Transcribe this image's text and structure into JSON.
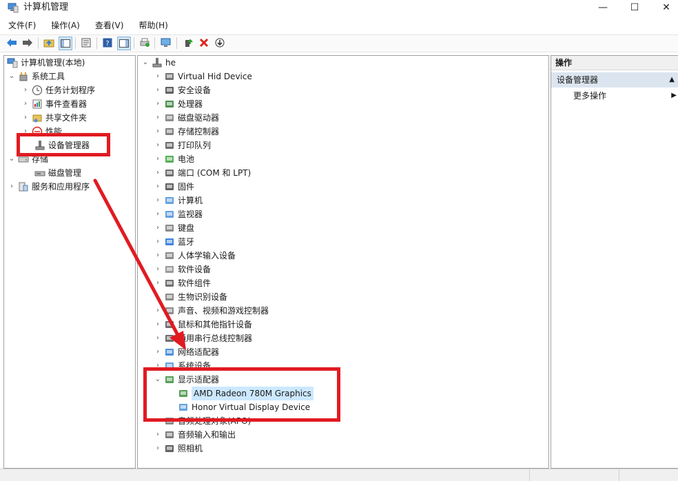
{
  "window": {
    "title": "计算机管理",
    "minimize": "—",
    "maximize": "☐",
    "close": "✕"
  },
  "menu": [
    "文件(F)",
    "操作(A)",
    "查看(V)",
    "帮助(H)"
  ],
  "left_tree": [
    {
      "label": "计算机管理(本地)",
      "icon": "computer-management-icon",
      "depth": 0,
      "arrow": ""
    },
    {
      "label": "系统工具",
      "icon": "tools-icon",
      "depth": 1,
      "arrow": "⌄"
    },
    {
      "label": "任务计划程序",
      "icon": "clock-icon",
      "depth": 2,
      "arrow": "›"
    },
    {
      "label": "事件查看器",
      "icon": "event-viewer-icon",
      "depth": 2,
      "arrow": "›"
    },
    {
      "label": "共享文件夹",
      "icon": "shared-folder-icon",
      "depth": 2,
      "arrow": "›"
    },
    {
      "label": "性能",
      "icon": "performance-icon",
      "depth": 2,
      "arrow": "›"
    },
    {
      "label": "设备管理器",
      "icon": "device-manager-icon",
      "depth": 2,
      "arrow": ""
    },
    {
      "label": "存储",
      "icon": "storage-icon",
      "depth": 1,
      "arrow": "⌄"
    },
    {
      "label": "磁盘管理",
      "icon": "disk-management-icon",
      "depth": 2,
      "arrow": ""
    },
    {
      "label": "服务和应用程序",
      "icon": "services-icon",
      "depth": 1,
      "arrow": "›"
    }
  ],
  "device_tree": {
    "root": "he",
    "categories": [
      {
        "label": "Virtual Hid Device",
        "icon": "hid-icon"
      },
      {
        "label": "安全设备",
        "icon": "security-device-icon"
      },
      {
        "label": "处理器",
        "icon": "processor-icon"
      },
      {
        "label": "磁盘驱动器",
        "icon": "disk-drive-icon"
      },
      {
        "label": "存储控制器",
        "icon": "storage-controller-icon"
      },
      {
        "label": "打印队列",
        "icon": "printer-icon"
      },
      {
        "label": "电池",
        "icon": "battery-icon"
      },
      {
        "label": "端口 (COM 和 LPT)",
        "icon": "port-icon"
      },
      {
        "label": "固件",
        "icon": "firmware-icon"
      },
      {
        "label": "计算机",
        "icon": "computer-icon"
      },
      {
        "label": "监视器",
        "icon": "monitor-icon"
      },
      {
        "label": "键盘",
        "icon": "keyboard-icon"
      },
      {
        "label": "蓝牙",
        "icon": "bluetooth-icon"
      },
      {
        "label": "人体学输入设备",
        "icon": "hid-input-icon"
      },
      {
        "label": "软件设备",
        "icon": "software-device-icon"
      },
      {
        "label": "软件组件",
        "icon": "software-component-icon"
      },
      {
        "label": "生物识别设备",
        "icon": "biometric-icon"
      },
      {
        "label": "声音、视频和游戏控制器",
        "icon": "sound-icon"
      },
      {
        "label": "鼠标和其他指针设备",
        "icon": "mouse-icon"
      },
      {
        "label": "通用串行总线控制器",
        "icon": "usb-icon"
      },
      {
        "label": "网络适配器",
        "icon": "network-adapter-icon"
      },
      {
        "label": "系统设备",
        "icon": "system-device-icon"
      },
      {
        "label": "显示适配器",
        "icon": "display-adapter-icon",
        "expanded": true
      },
      {
        "label": "AMD Radeon 780M Graphics",
        "icon": "display-adapter-icon",
        "child": true,
        "selected": true
      },
      {
        "label": "Honor Virtual Display Device",
        "icon": "virtual-display-icon",
        "child": true
      },
      {
        "label": "音频处理对象(APO)",
        "icon": "audio-processing-icon"
      },
      {
        "label": "音频输入和输出",
        "icon": "audio-io-icon"
      },
      {
        "label": "照相机",
        "icon": "camera-icon"
      }
    ]
  },
  "actions": {
    "header": "操作",
    "section": "设备管理器",
    "item": "更多操作"
  },
  "colors": {
    "annotation_red": "#e11b22",
    "selection": "#cce8ff",
    "section_bg": "#dbe5ef"
  }
}
